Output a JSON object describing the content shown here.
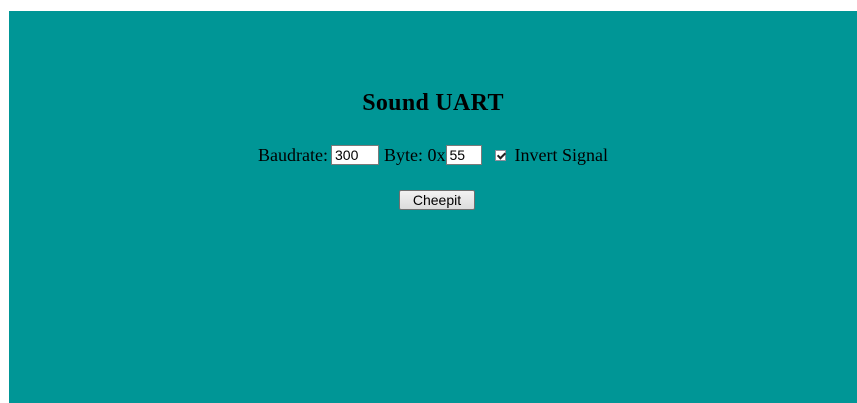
{
  "page": {
    "background": "#009696",
    "title": "Sound UART"
  },
  "form": {
    "baudrate_label": "Baudrate:",
    "baudrate_value": "300",
    "byte_label": "Byte: 0x",
    "byte_value": "55",
    "invert_checked": true,
    "invert_label": "Invert Signal",
    "button_label": "Cheepit"
  }
}
